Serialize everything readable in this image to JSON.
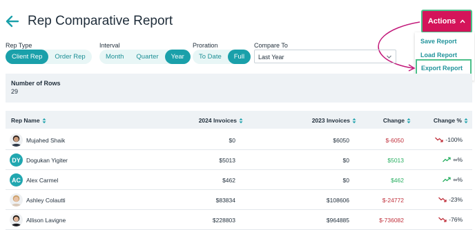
{
  "header": {
    "title": "Rep Comparative Report"
  },
  "actions": {
    "label": "Actions",
    "menu": {
      "save": "Save Report",
      "load": "Load Report",
      "export": "Export Report"
    }
  },
  "filters": {
    "rep_type": {
      "label": "Rep Type",
      "options": [
        "Client Rep",
        "Order Rep"
      ],
      "selected": "Client Rep"
    },
    "interval": {
      "label": "Interval",
      "options": [
        "Month",
        "Quarter",
        "Year"
      ],
      "selected": "Year"
    },
    "proration": {
      "label": "Proration",
      "options": [
        "To Date",
        "Full"
      ],
      "selected": "Full"
    },
    "compare_to": {
      "label": "Compare To",
      "value": "Last Year"
    }
  },
  "summary": {
    "label": "Number of Rows",
    "value": "29"
  },
  "table": {
    "columns": [
      "Rep Name",
      "2024 Invoices",
      "2023 Invoices",
      "Change",
      "Change %"
    ],
    "rows": [
      {
        "avatar": "photo",
        "initials": "",
        "name": "Mujahed Shaik",
        "inv2024": "$0",
        "inv2023": "$6050",
        "change": "$-6050",
        "change_dir": "neg",
        "pct": "-100%",
        "trend": "down"
      },
      {
        "avatar": "initials",
        "initials": "DY",
        "name": "Dogukan Yigiter",
        "inv2024": "$5013",
        "inv2023": "$0",
        "change": "$5013",
        "change_dir": "pos",
        "pct": "∞%",
        "trend": "up"
      },
      {
        "avatar": "initials",
        "initials": "AC",
        "name": "Alex Carmel",
        "inv2024": "$462",
        "inv2023": "$0",
        "change": "$462",
        "change_dir": "pos",
        "pct": "∞%",
        "trend": "up"
      },
      {
        "avatar": "photo",
        "initials": "",
        "name": "Ashley Colautti",
        "inv2024": "$83834",
        "inv2023": "$108606",
        "change": "$-24772",
        "change_dir": "neg",
        "pct": "-23%",
        "trend": "down"
      },
      {
        "avatar": "photo",
        "initials": "",
        "name": "Allison Lavigne",
        "inv2024": "$228803",
        "inv2023": "$964885",
        "change": "$-736082",
        "change_dir": "neg",
        "pct": "-76%",
        "trend": "down"
      }
    ]
  },
  "colors": {
    "accent": "#1aa0aa",
    "actions": "#d4145a",
    "highlight": "#4cbf8a",
    "negative": "#c0303b",
    "positive": "#27ae60"
  }
}
